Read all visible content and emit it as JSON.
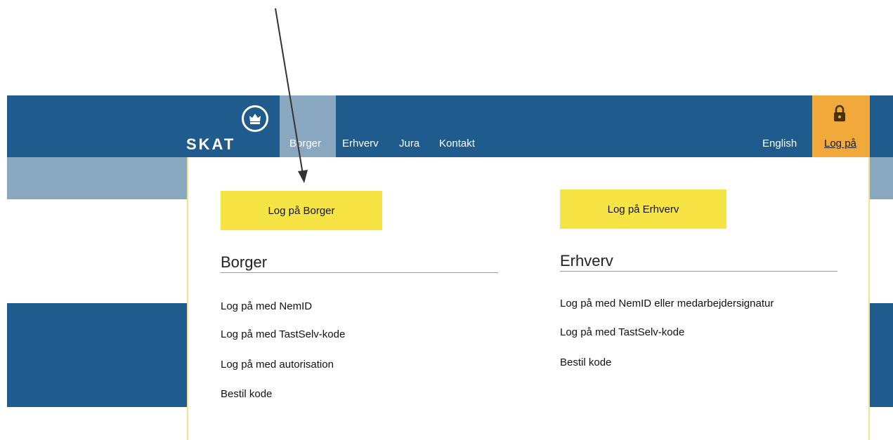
{
  "header": {
    "logo_text": "SKAT",
    "nav": [
      "Borger",
      "Erhverv",
      "Jura",
      "Kontakt"
    ],
    "language_link": "English",
    "login_label": "Log på",
    "icons": {
      "logo": "crown-emblem-icon",
      "login": "padlock-icon"
    },
    "colors": {
      "primary": "#1f5c8d",
      "secondary": "#8aa7c0",
      "login_tab": "#f2a93b",
      "button": "#f6e445"
    }
  },
  "menu": {
    "borger": {
      "button_label": "Log på Borger",
      "title": "Borger",
      "links": [
        "Log på med NemID",
        "Log på med TastSelv-kode",
        "Log på med autorisation",
        "Bestil kode"
      ]
    },
    "erhverv": {
      "button_label": "Log på Erhverv",
      "title": "Erhverv",
      "links": [
        "Log på med NemID eller medarbejdersignatur",
        "Log på med TastSelv-kode",
        "Bestil kode"
      ]
    }
  }
}
